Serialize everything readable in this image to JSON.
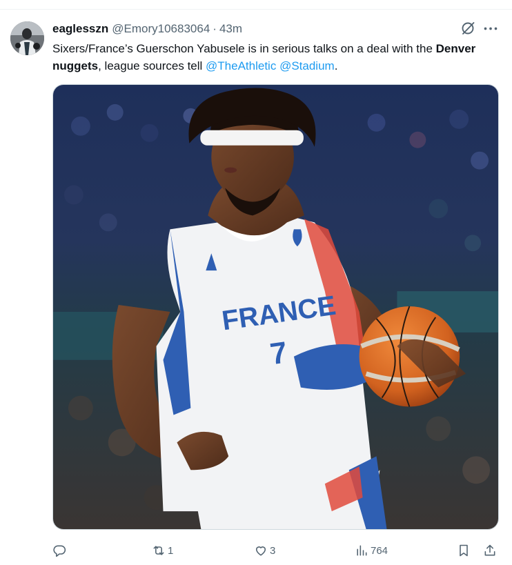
{
  "tweet": {
    "display_name": "eaglesszn",
    "handle": "@Emory10683064",
    "separator": "·",
    "time": "43m",
    "text": {
      "part1": "Sixers/France’s Guerschon Yabusele is in serious talks on a deal with the ",
      "bold": "Denver nuggets",
      "part2": ", league sources tell ",
      "mention1": "@TheAthletic",
      "space": " ",
      "mention2": "@Stadium",
      "end": "."
    },
    "media": {
      "jersey_text": "FRANCE",
      "jersey_number": "7"
    },
    "actions": {
      "reply_count": "",
      "retweet_count": "1",
      "like_count": "3",
      "views_count": "764"
    }
  },
  "colors": {
    "link": "#1d9bf0",
    "muted": "#536471",
    "text": "#0f1419",
    "jersey_blue": "#2f5fb3",
    "jersey_red": "#e04a3c"
  },
  "icons": {
    "grok": "grok-icon",
    "more": "more-icon",
    "reply": "reply-icon",
    "retweet": "retweet-icon",
    "like": "heart-icon",
    "views": "views-icon",
    "bookmark": "bookmark-icon",
    "share": "share-icon"
  }
}
